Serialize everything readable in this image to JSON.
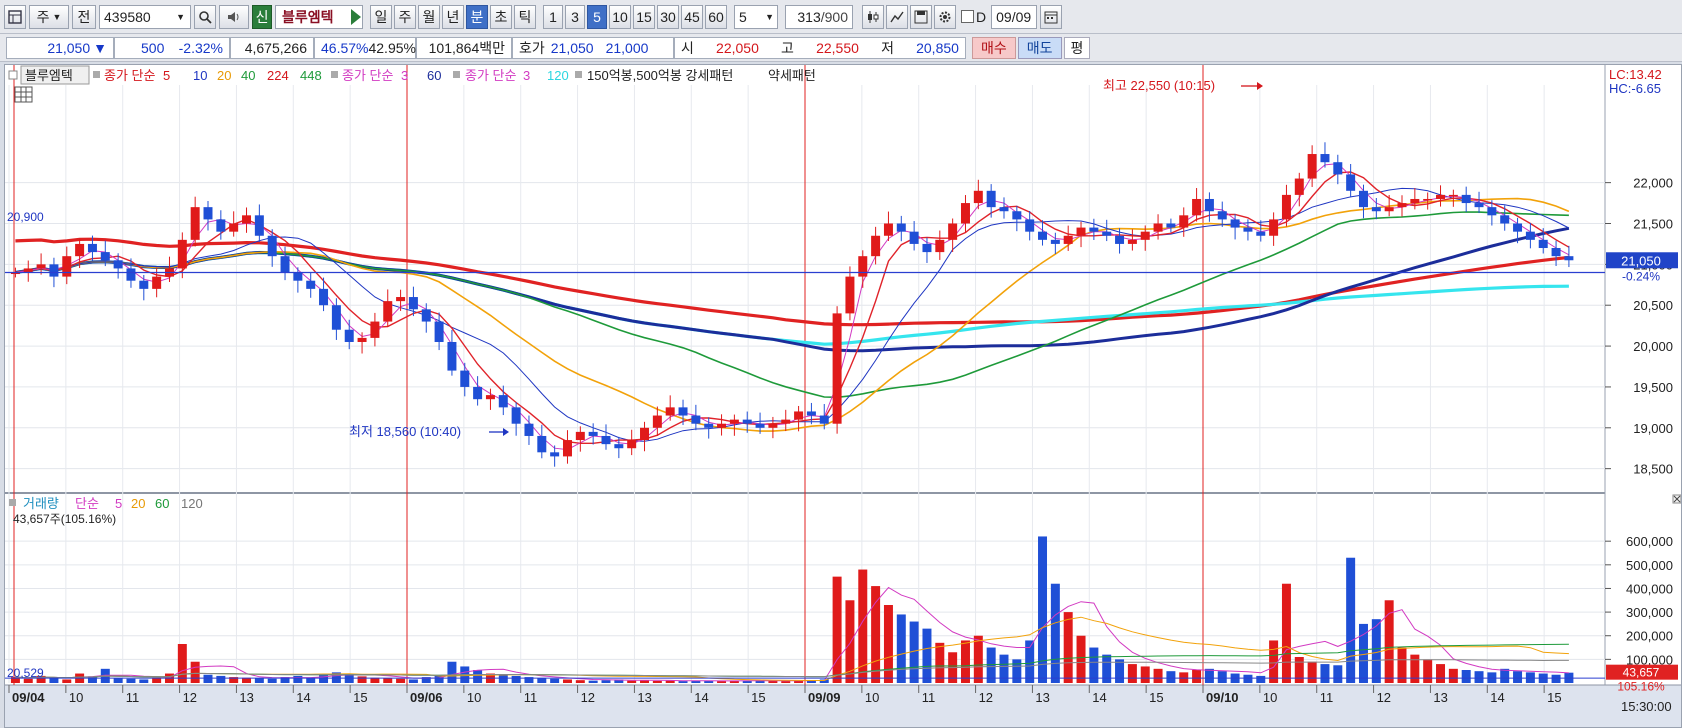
{
  "toolbar": {
    "market_label": "주",
    "prev_label": "전",
    "code": "439580",
    "name_badge": "신",
    "stock_name": "블루엠텍",
    "period_buttons": [
      "일",
      "주",
      "월",
      "년",
      "분",
      "초",
      "틱"
    ],
    "active_period": "분",
    "interval_buttons": [
      "1",
      "3",
      "5",
      "10",
      "15",
      "30",
      "45",
      "60"
    ],
    "active_interval": "5",
    "interval_select": "5",
    "count_display": "313",
    "count_total": "/900",
    "date_label": "D",
    "date_value": "09/09"
  },
  "quote": {
    "price": "21,050",
    "change_arrow": "▼",
    "change": "500",
    "change_pct": "-2.32%",
    "volume": "4,675,266",
    "ratio1": "46.57%",
    "ratio2": "42.95%",
    "amount": "101,864백만",
    "bid_label": "호가",
    "ask_price": "21,050",
    "bid_price": "21,000",
    "open_label": "시",
    "open": "22,050",
    "high_label": "고",
    "high": "22,550",
    "low_label": "저",
    "low": "20,850",
    "buy_label": "매수",
    "sell_label": "매도",
    "avg_label": "평"
  },
  "legend": {
    "stock_tag": "블루엠텍",
    "ma1_label": "종가 단순",
    "ma1_periods": [
      "5",
      "10",
      "20",
      "40",
      "224",
      "448"
    ],
    "ma2_label": "종가 단순",
    "ma2_periods": [
      "3",
      "60"
    ],
    "ma3_label": "종가 단순",
    "ma3_periods": [
      "3",
      "120"
    ],
    "pattern_text": "150억봉,500억봉 강세패턴",
    "weak_pattern_text": "약세패턴",
    "lc_text": "LC:13.42",
    "hc_text": "HC:-6.65",
    "left_price_marker": "20,900",
    "high_annotation": "최고 22,550 (10:15)",
    "low_annotation": "최저 18,560 (10:40)",
    "current_price_tag": "21,050",
    "current_price_pct": "-0.24%"
  },
  "volume_legend": {
    "label": "거래량",
    "ma_label": "단순",
    "periods": [
      "5",
      "20",
      "60",
      "120"
    ],
    "summary": "43,657주(105.16%)",
    "left_marker": "20,529",
    "current_tag": "43,657",
    "current_pct": "105.16%"
  },
  "colors": {
    "up": "#e01a1a",
    "down": "#1f4fd6",
    "ma5": "#e0232a",
    "ma10": "#1f36c2",
    "ma20": "#f2a20a",
    "ma40": "#1e9a3a",
    "ma224": "#e02222",
    "ma448": "#1b9a3a",
    "ma3": "#d23ac2",
    "ma60": "#1c2d9a",
    "ma120": "#35e5ee"
  },
  "chart_data": {
    "type": "candlestick",
    "price_axis": {
      "ticks": [
        18500,
        19000,
        19500,
        20000,
        20500,
        21000,
        21500,
        22000
      ],
      "ylim": [
        18300,
        22950
      ]
    },
    "volume_axis": {
      "ticks": [
        100000,
        200000,
        300000,
        400000,
        500000,
        600000
      ],
      "ylim": [
        0,
        660000
      ]
    },
    "x_ticks": [
      "09/04",
      "10",
      "11",
      "12",
      "13",
      "14",
      "15",
      "09/06",
      "10",
      "11",
      "12",
      "13",
      "14",
      "15",
      "09/09",
      "10",
      "11",
      "12",
      "13",
      "14",
      "15",
      "09/10",
      "10",
      "11",
      "12",
      "13",
      "14",
      "15"
    ],
    "day_separators": [
      "09/06",
      "09/09",
      "09/10"
    ],
    "time_label": "15:30:00",
    "highest": {
      "label": "최고",
      "value": 22550,
      "time": "10:15"
    },
    "lowest": {
      "label": "최저",
      "value": 18560,
      "time": "10:40"
    },
    "last_close": 21050,
    "horizontal_line": 20900,
    "close_series": [
      20900,
      20950,
      21000,
      20850,
      21100,
      21250,
      21150,
      21050,
      20950,
      20800,
      20700,
      20850,
      20950,
      21300,
      21700,
      21550,
      21400,
      21500,
      21600,
      21350,
      21100,
      20900,
      20800,
      20700,
      20500,
      20200,
      20050,
      20100,
      20300,
      20550,
      20600,
      20450,
      20300,
      20050,
      19700,
      19500,
      19350,
      19400,
      19250,
      19050,
      18900,
      18700,
      18650,
      18850,
      18950,
      18900,
      18800,
      18750,
      18850,
      19000,
      19150,
      19250,
      19150,
      19050,
      19000,
      19050,
      19100,
      19050,
      19000,
      19050,
      19100,
      19200,
      19150,
      19050,
      20400,
      20850,
      21100,
      21350,
      21500,
      21400,
      21250,
      21150,
      21300,
      21500,
      21750,
      21900,
      21700,
      21650,
      21550,
      21400,
      21300,
      21250,
      21350,
      21450,
      21400,
      21350,
      21250,
      21300,
      21400,
      21500,
      21450,
      21600,
      21800,
      21650,
      21550,
      21450,
      21400,
      21350,
      21550,
      21850,
      22050,
      22350,
      22250,
      22100,
      21900,
      21700,
      21650,
      21700,
      21750,
      21800,
      21800,
      21850,
      21850,
      21750,
      21700,
      21600,
      21500,
      21400,
      21300,
      21200,
      21100,
      21050
    ],
    "volume_series": [
      25000,
      18000,
      30000,
      22000,
      15000,
      40000,
      28000,
      60000,
      20000,
      18000,
      15000,
      22000,
      40000,
      165000,
      90000,
      35000,
      30000,
      25000,
      22000,
      20000,
      18000,
      25000,
      30000,
      22000,
      35000,
      45000,
      40000,
      28000,
      22000,
      20000,
      18000,
      15000,
      25000,
      30000,
      90000,
      70000,
      55000,
      40000,
      35000,
      30000,
      25000,
      20000,
      18000,
      15000,
      12000,
      10000,
      12000,
      15000,
      10000,
      12000,
      9000,
      10000,
      8000,
      9000,
      10000,
      8000,
      9000,
      10000,
      12000,
      9000,
      8000,
      10000,
      12000,
      15000,
      450000,
      350000,
      480000,
      410000,
      330000,
      290000,
      260000,
      230000,
      170000,
      130000,
      180000,
      200000,
      150000,
      120000,
      100000,
      180000,
      620000,
      420000,
      300000,
      200000,
      150000,
      120000,
      100000,
      80000,
      70000,
      60000,
      50000,
      45000,
      55000,
      60000,
      50000,
      40000,
      35000,
      30000,
      180000,
      420000,
      110000,
      90000,
      80000,
      75000,
      530000,
      250000,
      270000,
      350000,
      150000,
      120000,
      100000,
      80000,
      60000,
      55000,
      50000,
      45000,
      60000,
      50000,
      45000,
      40000,
      35000,
      43657
    ]
  }
}
